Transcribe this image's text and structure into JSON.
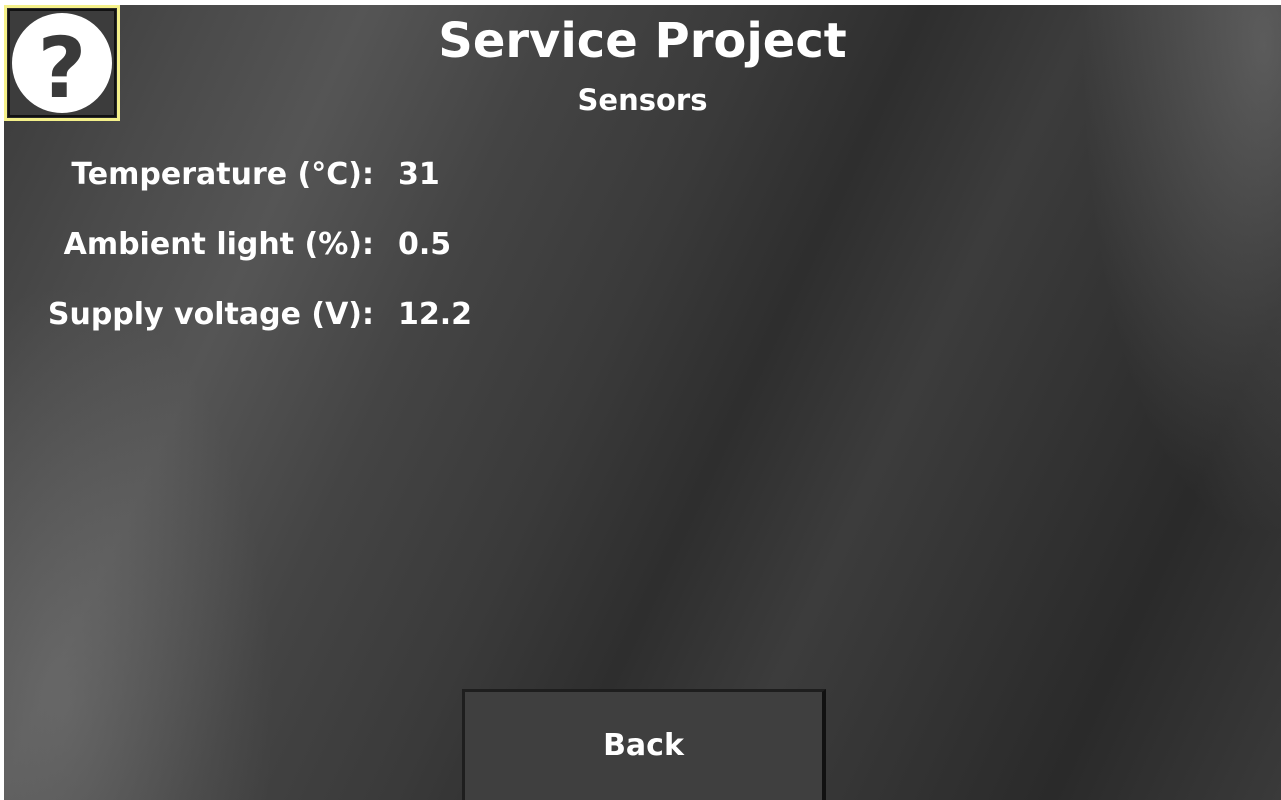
{
  "header": {
    "title": "Service Project",
    "subtitle": "Sensors"
  },
  "help_button": {
    "icon": "help-question-icon",
    "glyph": "?"
  },
  "sensors": [
    {
      "label": "Temperature (°C):",
      "value": "31"
    },
    {
      "label": "Ambient light (%):",
      "value": "0.5"
    },
    {
      "label": "Supply voltage (V):",
      "value": "12.2"
    }
  ],
  "footer": {
    "back_label": "Back"
  },
  "colors": {
    "focus_border": "#f4f08a",
    "text": "#ffffff",
    "background": "#3a3a3a"
  }
}
